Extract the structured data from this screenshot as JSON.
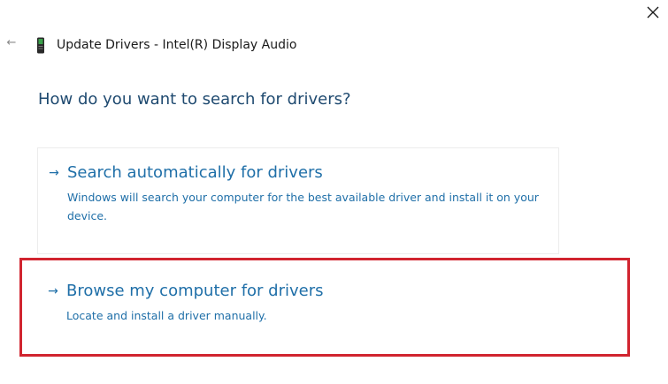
{
  "window": {
    "title": "Update Drivers - Intel(R) Display Audio"
  },
  "icons": {
    "back": "back-arrow-icon",
    "close": "close-icon",
    "device": "device-icon",
    "option_arrow": "right-arrow-icon"
  },
  "question": "How do you want to search for drivers?",
  "options": [
    {
      "title": "Search automatically for drivers",
      "description": "Windows will search your computer for the best available driver and install it on your device."
    },
    {
      "title": "Browse my computer for drivers",
      "description": "Locate and install a driver manually."
    }
  ],
  "colors": {
    "accent": "#1f6fa8",
    "heading": "#1f4a70",
    "highlight": "#d1242f"
  }
}
